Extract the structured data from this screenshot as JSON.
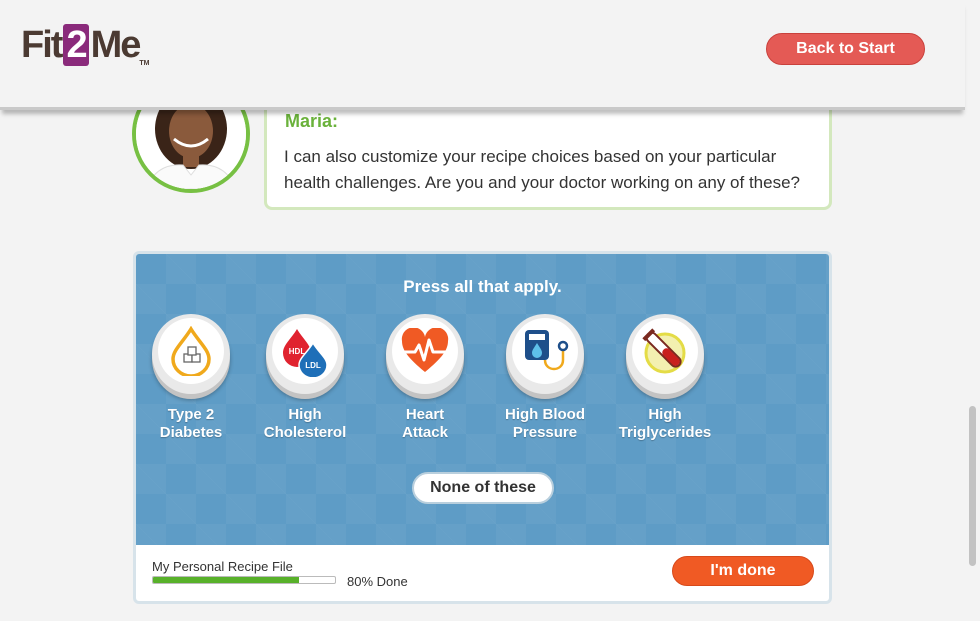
{
  "header": {
    "logo_part1": "Fit",
    "logo_part2": "2",
    "logo_part3": "Me",
    "logo_tm": "TM",
    "back_button_label": "Back to Start"
  },
  "chat": {
    "speaker": "Maria:",
    "message": "I can also customize your recipe choices based on your particular health challenges. Are you and your doctor working on any of these?"
  },
  "panel": {
    "instruction": "Press all that apply.",
    "options": [
      {
        "line1": "Type 2",
        "line2": "Diabetes",
        "icon": "sugar-drop-icon"
      },
      {
        "line1": "High",
        "line2": "Cholesterol",
        "icon": "hdl-ldl-drops-icon",
        "icon_text1": "HDL",
        "icon_text2": "LDL"
      },
      {
        "line1": "Heart",
        "line2": "Attack",
        "icon": "heart-pulse-icon"
      },
      {
        "line1": "High Blood",
        "line2": "Pressure",
        "icon": "blood-pressure-monitor-icon"
      },
      {
        "line1": "High",
        "line2": "Triglycerides",
        "icon": "test-tube-icon"
      }
    ],
    "none_label": "None of these"
  },
  "footer": {
    "recipe_file_label": "My Personal Recipe File",
    "progress_percent": 80,
    "progress_text": "80% Done",
    "done_label": "I'm done"
  },
  "colors": {
    "brand_purple": "#8a2a7b",
    "back_button": "#e45a55",
    "accent_green": "#77c043",
    "panel_blue": "#5e9cc6",
    "done_button": "#f05a24",
    "progress_green": "#58b12a"
  }
}
